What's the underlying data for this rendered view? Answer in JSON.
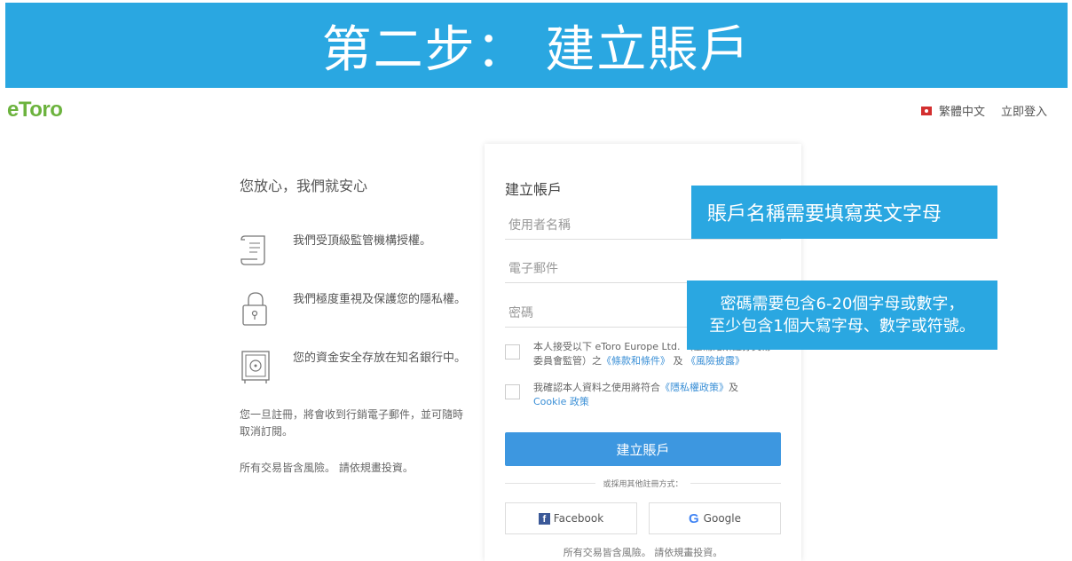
{
  "banner": {
    "title": "第二步： 建立賬戶"
  },
  "header": {
    "logo": "eToro",
    "language": "繁體中文",
    "login": "立即登入"
  },
  "left": {
    "headline": "您放心，我們就安心",
    "features": [
      {
        "icon": "scroll-icon",
        "text": "我們受頂級監管機構授權。"
      },
      {
        "icon": "padlock-icon",
        "text": "我們極度重視及保護您的隱私權。"
      },
      {
        "icon": "safe-icon",
        "text": "您的資金安全存放在知名銀行中。"
      }
    ],
    "note": "您一旦註冊，將會收到行銷電子郵件，並可隨時取消訂閱。",
    "risk": "所有交易皆含風險。 請依規畫投資。"
  },
  "form": {
    "title": "建立帳戶",
    "username_placeholder": "使用者名稱",
    "email_placeholder": "電子郵件",
    "password_placeholder": "密碼",
    "terms_text": "本人接受以下 eToro Europe Ltd. （塞浦路斯證券交易委員會監管）之",
    "terms_link1": "《條款和條件》",
    "terms_and": " 及 ",
    "terms_link2": "《風險披露》",
    "privacy_text": "我確認本人資料之使用將符合",
    "privacy_link": "《隱私權政策》",
    "privacy_and": "及",
    "cookie_link": "Cookie 政策",
    "submit": "建立賬戶",
    "or_text": "或採用其他註冊方式：",
    "facebook": "Facebook",
    "google": "Google",
    "footer": "所有交易皆含風險。 請依規畫投資。"
  },
  "callouts": {
    "account_name": "賬戶名稱需要填寫英文字母",
    "password_line1": "密碼需要包含6-20個字母或數字，",
    "password_line2": "至少包含1個大寫字母、數字或符號。"
  },
  "colors": {
    "accent": "#2aa7e1",
    "button": "#3d97e0",
    "logo": "#6cb33e"
  }
}
